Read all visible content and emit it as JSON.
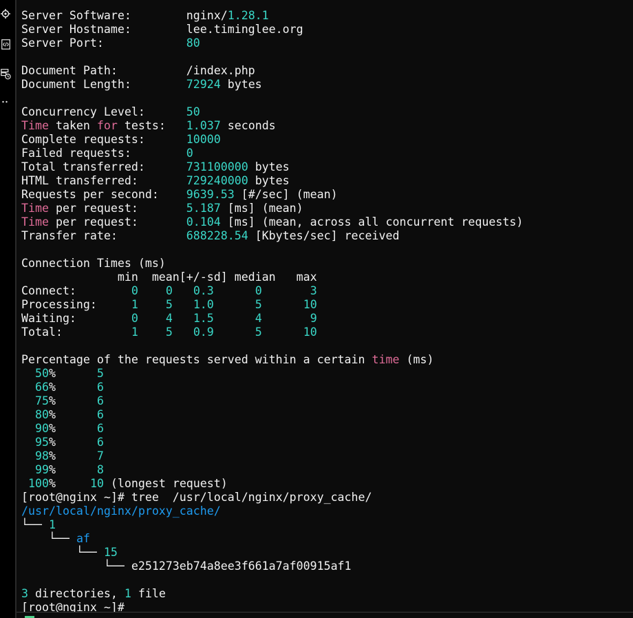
{
  "colors": {
    "number": "#3ad8c8",
    "keyword": "#e06c98",
    "directory": "#1e9bf0",
    "text": "#f2f2f2",
    "background": "#0c0c0c"
  },
  "sidebar_icons": [
    "target-icon",
    "code-file-icon",
    "server-clock-icon",
    "more-icon"
  ],
  "terminal": {
    "lines": [
      [
        {
          "t": "Server Software:        nginx/"
        },
        {
          "t": "1.28.1",
          "c": "num"
        }
      ],
      [
        {
          "t": "Server Hostname:        lee.timinglee.org"
        }
      ],
      [
        {
          "t": "Server Port:            "
        },
        {
          "t": "80",
          "c": "num"
        }
      ],
      [],
      [
        {
          "t": "Document Path:          /index.php"
        }
      ],
      [
        {
          "t": "Document Length:        "
        },
        {
          "t": "72924",
          "c": "num"
        },
        {
          "t": " bytes"
        }
      ],
      [],
      [
        {
          "t": "Concurrency Level:      "
        },
        {
          "t": "50",
          "c": "num"
        }
      ],
      [
        {
          "t": "Time",
          "c": "kw"
        },
        {
          "t": " taken "
        },
        {
          "t": "for",
          "c": "kw"
        },
        {
          "t": " tests:   "
        },
        {
          "t": "1.037",
          "c": "num"
        },
        {
          "t": " seconds"
        }
      ],
      [
        {
          "t": "Complete requests:      "
        },
        {
          "t": "10000",
          "c": "num"
        }
      ],
      [
        {
          "t": "Failed requests:        "
        },
        {
          "t": "0",
          "c": "num"
        }
      ],
      [
        {
          "t": "Total transferred:      "
        },
        {
          "t": "731100000",
          "c": "num"
        },
        {
          "t": " bytes"
        }
      ],
      [
        {
          "t": "HTML transferred:       "
        },
        {
          "t": "729240000",
          "c": "num"
        },
        {
          "t": " bytes"
        }
      ],
      [
        {
          "t": "Requests per second:    "
        },
        {
          "t": "9639.53",
          "c": "num"
        },
        {
          "t": " [#/sec] (mean)"
        }
      ],
      [
        {
          "t": "Time",
          "c": "kw"
        },
        {
          "t": " per request:       "
        },
        {
          "t": "5.187",
          "c": "num"
        },
        {
          "t": " [ms] (mean)"
        }
      ],
      [
        {
          "t": "Time",
          "c": "kw"
        },
        {
          "t": " per request:       "
        },
        {
          "t": "0.104",
          "c": "num"
        },
        {
          "t": " [ms] (mean, across all concurrent requests)"
        }
      ],
      [
        {
          "t": "Transfer rate:          "
        },
        {
          "t": "688228.54",
          "c": "num"
        },
        {
          "t": " [Kbytes/sec] received"
        }
      ],
      [],
      [
        {
          "t": "Connection Times (ms)"
        }
      ],
      [
        {
          "t": "              min  mean[+/-sd] median   max"
        }
      ],
      [
        {
          "t": "Connect:        "
        },
        {
          "t": "0",
          "c": "num"
        },
        {
          "t": "    "
        },
        {
          "t": "0",
          "c": "num"
        },
        {
          "t": "   "
        },
        {
          "t": "0.3",
          "c": "num"
        },
        {
          "t": "      "
        },
        {
          "t": "0",
          "c": "num"
        },
        {
          "t": "       "
        },
        {
          "t": "3",
          "c": "num"
        }
      ],
      [
        {
          "t": "Processing:     "
        },
        {
          "t": "1",
          "c": "num"
        },
        {
          "t": "    "
        },
        {
          "t": "5",
          "c": "num"
        },
        {
          "t": "   "
        },
        {
          "t": "1.0",
          "c": "num"
        },
        {
          "t": "      "
        },
        {
          "t": "5",
          "c": "num"
        },
        {
          "t": "      "
        },
        {
          "t": "10",
          "c": "num"
        }
      ],
      [
        {
          "t": "Waiting:        "
        },
        {
          "t": "0",
          "c": "num"
        },
        {
          "t": "    "
        },
        {
          "t": "4",
          "c": "num"
        },
        {
          "t": "   "
        },
        {
          "t": "1.5",
          "c": "num"
        },
        {
          "t": "      "
        },
        {
          "t": "4",
          "c": "num"
        },
        {
          "t": "       "
        },
        {
          "t": "9",
          "c": "num"
        }
      ],
      [
        {
          "t": "Total:          "
        },
        {
          "t": "1",
          "c": "num"
        },
        {
          "t": "    "
        },
        {
          "t": "5",
          "c": "num"
        },
        {
          "t": "   "
        },
        {
          "t": "0.9",
          "c": "num"
        },
        {
          "t": "      "
        },
        {
          "t": "5",
          "c": "num"
        },
        {
          "t": "      "
        },
        {
          "t": "10",
          "c": "num"
        }
      ],
      [],
      [
        {
          "t": "Percentage of the requests served within a certain "
        },
        {
          "t": "time",
          "c": "kw"
        },
        {
          "t": " (ms)"
        }
      ],
      [
        {
          "t": "  "
        },
        {
          "t": "50",
          "c": "num"
        },
        {
          "t": "%      "
        },
        {
          "t": "5",
          "c": "num"
        }
      ],
      [
        {
          "t": "  "
        },
        {
          "t": "66",
          "c": "num"
        },
        {
          "t": "%      "
        },
        {
          "t": "6",
          "c": "num"
        }
      ],
      [
        {
          "t": "  "
        },
        {
          "t": "75",
          "c": "num"
        },
        {
          "t": "%      "
        },
        {
          "t": "6",
          "c": "num"
        }
      ],
      [
        {
          "t": "  "
        },
        {
          "t": "80",
          "c": "num"
        },
        {
          "t": "%      "
        },
        {
          "t": "6",
          "c": "num"
        }
      ],
      [
        {
          "t": "  "
        },
        {
          "t": "90",
          "c": "num"
        },
        {
          "t": "%      "
        },
        {
          "t": "6",
          "c": "num"
        }
      ],
      [
        {
          "t": "  "
        },
        {
          "t": "95",
          "c": "num"
        },
        {
          "t": "%      "
        },
        {
          "t": "6",
          "c": "num"
        }
      ],
      [
        {
          "t": "  "
        },
        {
          "t": "98",
          "c": "num"
        },
        {
          "t": "%      "
        },
        {
          "t": "7",
          "c": "num"
        }
      ],
      [
        {
          "t": "  "
        },
        {
          "t": "99",
          "c": "num"
        },
        {
          "t": "%      "
        },
        {
          "t": "8",
          "c": "num"
        }
      ],
      [
        {
          "t": " "
        },
        {
          "t": "100",
          "c": "num"
        },
        {
          "t": "%     "
        },
        {
          "t": "10",
          "c": "num"
        },
        {
          "t": " (longest request)"
        }
      ],
      [
        {
          "t": "[root@nginx ~]# tree  /usr/local/nginx/proxy_cache/"
        }
      ],
      [
        {
          "t": "/usr/local/nginx/proxy_cache/",
          "c": "dir"
        }
      ],
      [
        {
          "t": "└── "
        },
        {
          "t": "1",
          "c": "num"
        }
      ],
      [
        {
          "t": "    └── "
        },
        {
          "t": "af",
          "c": "dir"
        }
      ],
      [
        {
          "t": "        └── "
        },
        {
          "t": "15",
          "c": "num"
        }
      ],
      [
        {
          "t": "            └── e251273eb74a8ee3f661a7af00915af1"
        }
      ],
      [],
      [
        {
          "t": "3",
          "c": "num"
        },
        {
          "t": " directories, "
        },
        {
          "t": "1",
          "c": "num"
        },
        {
          "t": " file"
        }
      ],
      [
        {
          "t": "[root@nginx ~]#"
        }
      ]
    ]
  }
}
